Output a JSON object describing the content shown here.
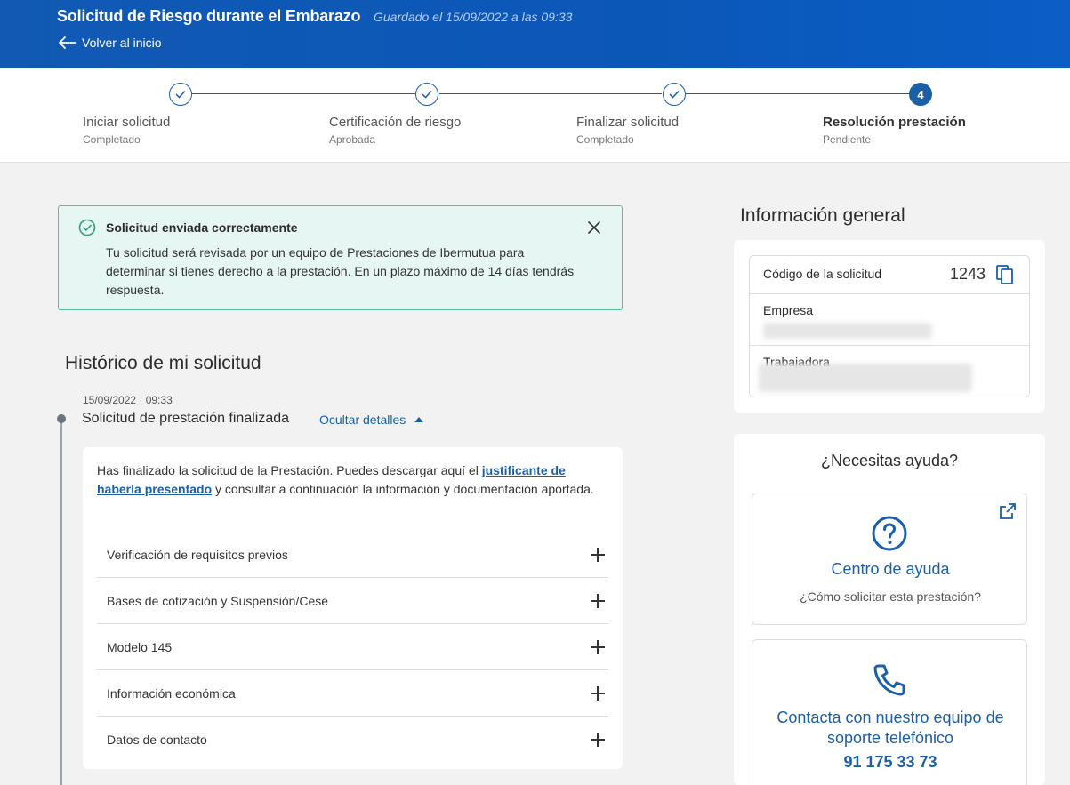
{
  "header": {
    "title": "Solicitud de Riesgo durante el Embarazo",
    "saved": "Guardado el 15/09/2022 a las 09:33",
    "back_label": "Volver al inicio",
    "icons": {
      "back": "arrow-left-icon"
    }
  },
  "stepper": {
    "steps": [
      {
        "label": "Iniciar solicitud",
        "status": "Completado",
        "state": "done"
      },
      {
        "label": "Certificación de riesgo",
        "status": "Aprobada",
        "state": "done"
      },
      {
        "label": "Finalizar solicitud",
        "status": "Completado",
        "state": "done"
      },
      {
        "label": "Resolución prestación",
        "status": "Pendiente",
        "state": "active",
        "number": "4"
      }
    ]
  },
  "alert": {
    "title": "Solicitud enviada correctamente",
    "text": "Tu solicitud será revisada por un equipo de Prestaciones de Ibermutua para determinar si tienes derecho a la prestación. En un plazo máximo de 14 días tendrás respuesta.",
    "icons": {
      "status": "check-circle-icon",
      "close": "close-icon"
    },
    "color": "#55bfa6"
  },
  "history": {
    "title": "Histórico de mi solicitud",
    "event": {
      "date": "15/09/2022 · 09:33",
      "title": "Solicitud de prestación finalizada",
      "toggle_label": "Ocultar detalles",
      "text_before": "Has finalizado la solicitud de la Prestación. Puedes descargar aquí el ",
      "link_text": "justificante de haberla presentado",
      "text_after": " y consultar a continuación la información y documentación aportada.",
      "sections": [
        "Verificación de requisitos previos",
        "Bases de cotización y Suspensión/Cese",
        "Modelo 145",
        "Información económica",
        "Datos de contacto"
      ]
    }
  },
  "info": {
    "title": "Información general",
    "code_label": "Código de la solicitud",
    "code_value": "1243",
    "company_label": "Empresa",
    "worker_label": "Trabajadora",
    "icons": {
      "copy": "copy-icon"
    }
  },
  "help": {
    "title": "¿Necesitas ayuda?",
    "center_link": "Centro de ayuda",
    "center_sub": "¿Cómo solicitar esta prestación?",
    "phone_text": "Contacta con nuestro equipo de soporte telefónico",
    "phone_number": "91 175 33 73",
    "icons": {
      "external": "external-link-icon",
      "question": "question-circle-icon",
      "phone": "phone-icon"
    }
  },
  "colors": {
    "primary": "#1a5fa8",
    "header": "#0b57b8",
    "success": "#55bfa6"
  }
}
